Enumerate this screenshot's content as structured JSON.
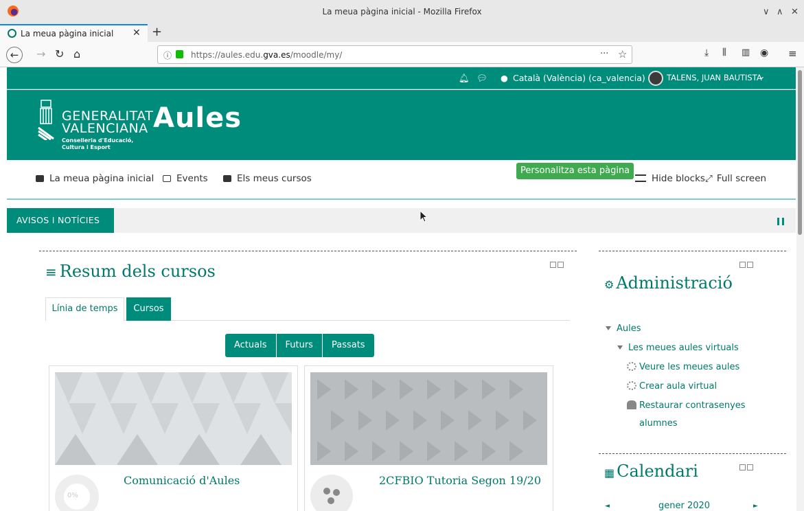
{
  "window": {
    "title": "La meua pàgina inicial - Mozilla Firefox",
    "controls": [
      "∨",
      "∧",
      "✕"
    ]
  },
  "tabs": [
    {
      "label": "La meua pàgina inicial",
      "close": "✕"
    }
  ],
  "new_tab": "+",
  "navbar": {
    "url_prefix": "https://aules.edu.",
    "url_domain": "gva.es",
    "url_suffix": "/moodle/my/",
    "page_actions": "···",
    "bookmark": "☆"
  },
  "colors": {
    "brand": "#008c7a",
    "accent_text": "#00796b",
    "personalize": "#3faa4f"
  },
  "topbar": {
    "language": "Català (València) (ca_valencia)",
    "user": "TALENS, JUAN BAUTISTA",
    "user_caret": "⌄"
  },
  "header": {
    "org_line1": "GENERALITAT",
    "org_line2": "VALENCIANA",
    "org_sub1": "Conselleria d'Educació,",
    "org_sub2": "Cultura i Esport",
    "brand": "Aules"
  },
  "nav": {
    "home": "La meua pàgina inicial",
    "events": "Events",
    "courses": "Els meus cursos",
    "personalize": "Personalitza esta pàgina",
    "hide_blocks": "Hide blocks",
    "full_screen": "Full screen"
  },
  "news": {
    "label": "AVISOS I NOTÍCIES"
  },
  "overview": {
    "title": "Resum dels cursos",
    "tabs": [
      "Línia de temps",
      "Cursos"
    ],
    "active_tab": "Cursos",
    "filters": [
      "Actuals",
      "Futurs",
      "Passats"
    ],
    "courses": [
      {
        "title": "Comunicació d'Aules",
        "progress": "0%"
      },
      {
        "title": "2CFBIO Tutoria Segon 19/20"
      }
    ]
  },
  "admin": {
    "title": "Administració",
    "root": "Aules",
    "group": "Les meues aules virtuals",
    "items": [
      "Veure les meues aules",
      "Crear aula virtual",
      "Restaurar contrasenyes",
      "alumnes"
    ]
  },
  "calendar": {
    "title": "Calendari",
    "month": "gener 2020",
    "prev": "◄",
    "next": "►"
  }
}
